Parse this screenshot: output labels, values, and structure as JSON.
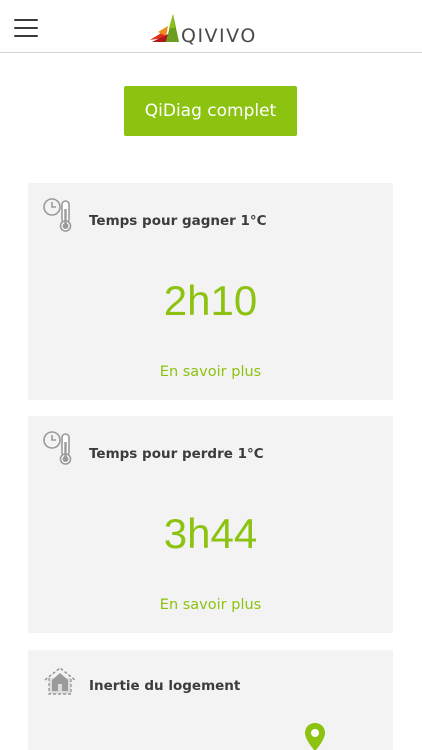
{
  "header": {
    "logo_text": "QIVIVO",
    "menu_icon": "hamburger-menu-icon"
  },
  "cta": {
    "label": "QiDiag complet"
  },
  "cards": [
    {
      "icon": "clock-thermometer-icon",
      "title": "Temps pour gagner 1°C",
      "value": "2h10",
      "link": "En savoir plus"
    },
    {
      "icon": "clock-thermometer-icon",
      "title": "Temps pour perdre 1°C",
      "value": "3h44",
      "link": "En savoir plus"
    },
    {
      "icon": "house-icon",
      "title": "Inertie du logement",
      "marker_icon": "location-pin-icon"
    }
  ],
  "colors": {
    "accent": "#8cc210",
    "card_bg": "#f3f3f3",
    "text": "#3c3c3c"
  }
}
